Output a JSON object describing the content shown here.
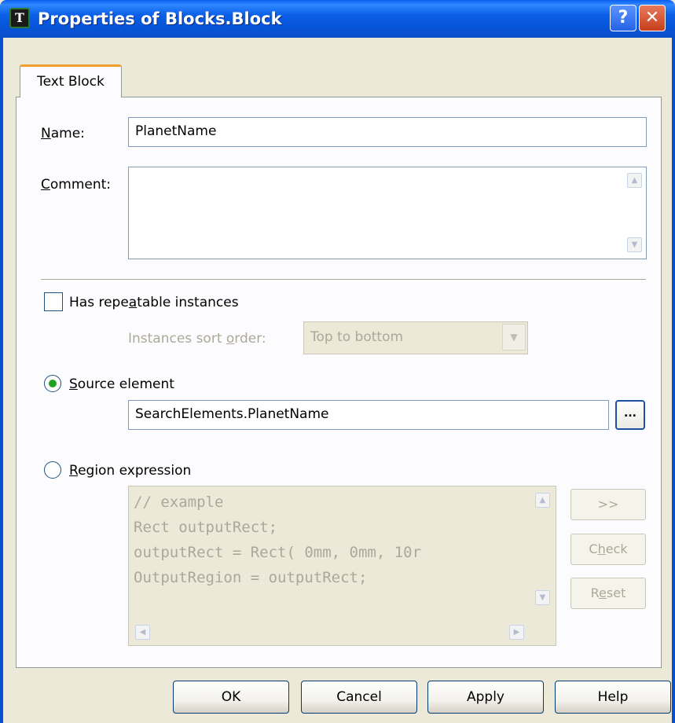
{
  "window": {
    "title": "Properties of Blocks.Block",
    "icon_letter": "T",
    "help_glyph": "?",
    "close_glyph": "✕"
  },
  "tabs": [
    {
      "label": "Text Block",
      "selected": true
    }
  ],
  "fields": {
    "name": {
      "label_u": "N",
      "label_rest": "ame:",
      "value": "PlanetName"
    },
    "comment": {
      "label_u": "C",
      "label_rest": "omment:",
      "value": ""
    }
  },
  "repeatable": {
    "label_pre": "Has repe",
    "label_u": "a",
    "label_post": "table instances",
    "checked": false,
    "sort_label_pre": "Instances sort ",
    "sort_label_u": "o",
    "sort_label_post": "rder:",
    "sort_value": "Top to bottom"
  },
  "source": {
    "label_u": "S",
    "label_rest": "ource element",
    "selected": true,
    "value": "SearchElements.PlanetName",
    "browse_label": "..."
  },
  "region": {
    "label_u": "R",
    "label_rest": "egion expression",
    "selected": false,
    "code_lines": [
      "// example",
      "Rect outputRect;",
      "outputRect = Rect( 0mm, 0mm, 10r",
      "OutputRegion = outputRect;"
    ],
    "insert_label": ">>",
    "check_label_pre": "C",
    "check_label_u": "h",
    "check_label_post": "eck",
    "reset_label_pre": "R",
    "reset_label_u": "e",
    "reset_label_post": "set"
  },
  "buttons": {
    "ok": "OK",
    "cancel": "Cancel",
    "apply": "Apply",
    "help": "Help"
  }
}
